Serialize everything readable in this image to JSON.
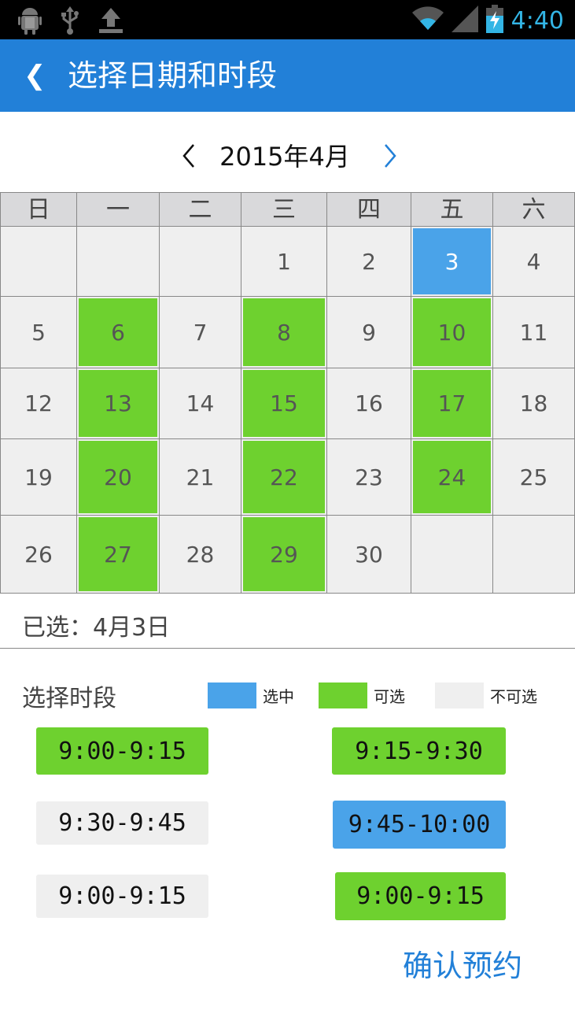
{
  "status_bar": {
    "icons": [
      "android-icon",
      "usb-icon",
      "upload-icon",
      "wifi-icon",
      "signal-icon",
      "battery-charging-icon"
    ],
    "time": "4:40"
  },
  "header": {
    "back_glyph": "❮",
    "title": "选择日期和时段"
  },
  "month_nav": {
    "label": "2015年4月",
    "prev_glyph": "‹",
    "next_glyph": "›"
  },
  "calendar": {
    "weekdays": [
      "日",
      "一",
      "二",
      "三",
      "四",
      "五",
      "六"
    ],
    "weeks": [
      [
        {
          "d": ""
        },
        {
          "d": ""
        },
        {
          "d": ""
        },
        {
          "d": "1"
        },
        {
          "d": "2"
        },
        {
          "d": "3",
          "s": "selected"
        },
        {
          "d": "4"
        }
      ],
      [
        {
          "d": "5"
        },
        {
          "d": "6",
          "s": "avail"
        },
        {
          "d": "7"
        },
        {
          "d": "8",
          "s": "avail"
        },
        {
          "d": "9"
        },
        {
          "d": "10",
          "s": "avail"
        },
        {
          "d": "11"
        }
      ],
      [
        {
          "d": "12"
        },
        {
          "d": "13",
          "s": "avail"
        },
        {
          "d": "14"
        },
        {
          "d": "15",
          "s": "avail"
        },
        {
          "d": "16"
        },
        {
          "d": "17",
          "s": "avail"
        },
        {
          "d": "18"
        }
      ],
      [
        {
          "d": "19"
        },
        {
          "d": "20",
          "s": "avail"
        },
        {
          "d": "21"
        },
        {
          "d": "22",
          "s": "avail"
        },
        {
          "d": "23"
        },
        {
          "d": "24",
          "s": "avail"
        },
        {
          "d": "25"
        }
      ],
      [
        {
          "d": "26"
        },
        {
          "d": "27",
          "s": "avail"
        },
        {
          "d": "28"
        },
        {
          "d": "29",
          "s": "avail"
        },
        {
          "d": "30"
        },
        {
          "d": ""
        },
        {
          "d": ""
        }
      ]
    ]
  },
  "selected_text": "已选：4月3日",
  "slots_section": {
    "title": "选择时段",
    "legend": [
      {
        "label": "选中",
        "color": "#4aa3e9"
      },
      {
        "label": "可选",
        "color": "#6ed12f"
      },
      {
        "label": "不可选",
        "color": "#efefef"
      }
    ],
    "slots": [
      {
        "label": "9:00-9:15",
        "state": "avail"
      },
      {
        "label": "9:15-9:30",
        "state": "avail"
      },
      {
        "label": "9:30-9:45",
        "state": "unavail"
      },
      {
        "label": "9:45-10:00",
        "state": "selected"
      },
      {
        "label": "9:00-9:15",
        "state": "unavail"
      },
      {
        "label": "9:00-9:15",
        "state": "avail"
      }
    ]
  },
  "confirm_label": "确认预约",
  "colors": {
    "primary": "#2280d8",
    "selected": "#4aa3e9",
    "available": "#6ed12f",
    "unavailable": "#efefef"
  }
}
